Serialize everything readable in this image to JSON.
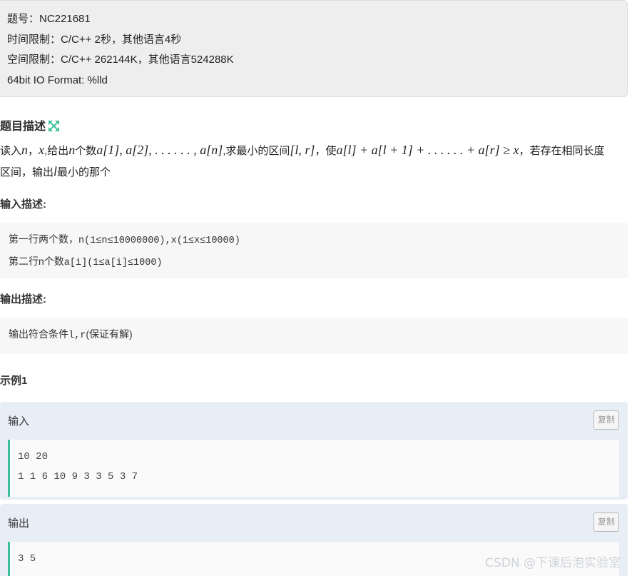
{
  "info": {
    "lines": [
      "题号：NC221681",
      "时间限制：C/C++ 2秒，其他语言4秒",
      "空间限制：C/C++ 262144K，其他语言524288K",
      "64bit IO Format: %lld"
    ]
  },
  "description": {
    "title": "题目描述",
    "expand_icon": "expand-arrows-icon",
    "line1": {
      "t1": "读入",
      "n": "n",
      "t2": "，",
      "x": "x",
      "t3": ",给出",
      "n2": "n",
      "t4": "个数",
      "arr": "a[1], a[2], . . . . . . , a[n]",
      "t5": ",求最小的区间",
      "range": "[l, r]",
      "t6": "，使",
      "expr": "a[l] + a[l + 1] + . . . . . . + a[r] ≥ x",
      "t7": "，若存在相同长度"
    },
    "line2": {
      "t1": "区间，输出",
      "l": "l",
      "t2": "最小的那个"
    }
  },
  "input_desc": {
    "title": "输入描述:",
    "line1": {
      "text1": "第一行两个数，",
      "mono": "n(1≤n≤10000000),x(1≤x≤10000)"
    },
    "line2": {
      "text1": "第二行n个数",
      "mono": "a[i](1≤a[i]≤1000)"
    }
  },
  "output_desc": {
    "title": "输出描述:",
    "line1": {
      "text1": "输出符合条件",
      "mono": "l,r",
      "text2": "(保证有解)"
    }
  },
  "example": {
    "title": "示例1",
    "input_label": "输入",
    "input_lines": [
      "10 20",
      "1 1 6 10 9 3 3 5 3 7"
    ],
    "output_label": "输出",
    "output_lines": [
      "3 5"
    ],
    "copy_label": "复制"
  },
  "watermark": "CSDN @下课后泡实验室",
  "colors": {
    "accent": "#3cbf9c",
    "example_bg": "#e8eef6",
    "info_bg": "#eeeeee"
  }
}
